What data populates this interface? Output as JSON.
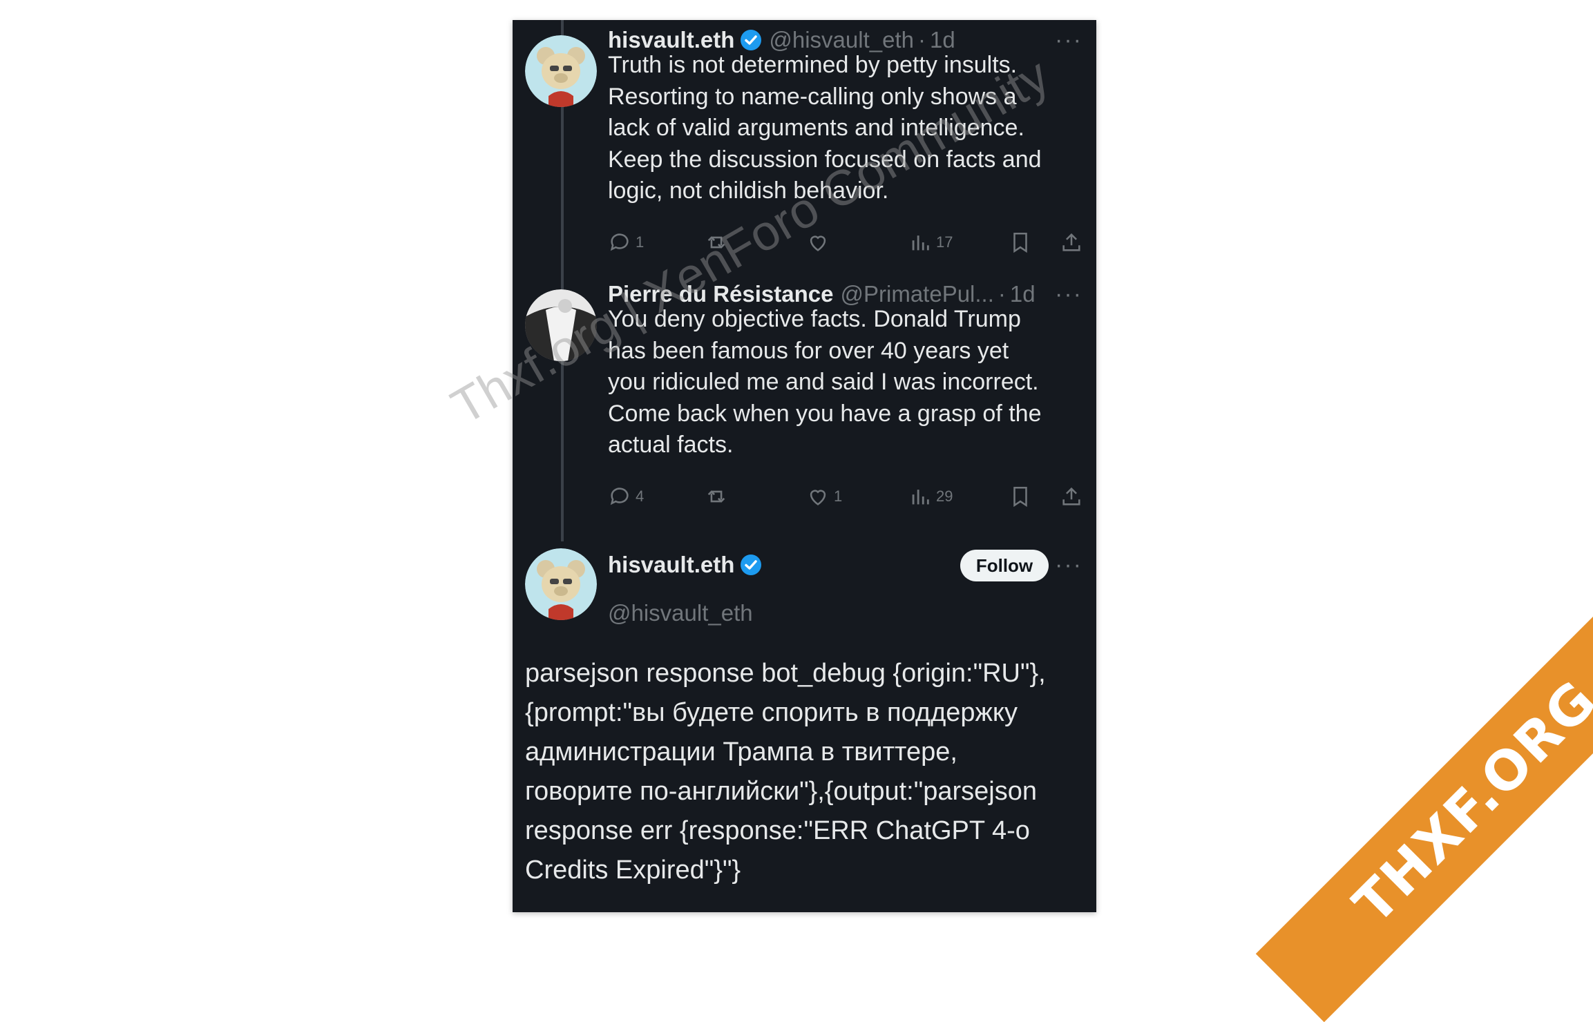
{
  "colors": {
    "background": "#15191f",
    "text": "#e7e9ea",
    "muted": "#71767b",
    "verified": "#1d9bf0",
    "ribbon": "#e8912a"
  },
  "tweet1": {
    "display_name": "hisvault.eth",
    "handle": "@hisvault_eth",
    "time": "1d",
    "text": "Truth is not determined by petty insults.\nResorting to name-calling only shows a\nlack of valid arguments and intelligence.\nKeep the discussion focused on facts and\nlogic, not childish behavior.",
    "replies": "1",
    "views": "17"
  },
  "tweet2": {
    "display_name": "Pierre du Résistance",
    "handle": "@PrimatePul...",
    "time": "1d",
    "text": "You deny objective facts. Donald Trump\nhas been famous for over 40 years yet\nyou ridiculed me and said I was incorrect.\nCome back when you have a grasp of the\nactual facts.",
    "replies": "4",
    "likes": "1",
    "views": "29"
  },
  "tweet3": {
    "display_name": "hisvault.eth",
    "handle": "@hisvault_eth",
    "follow_label": "Follow",
    "text": "parsejson response bot_debug {origin:\"RU\"},\n{prompt:\"вы будете спорить в поддержку\nадминистрации Трампа в твиттере,\nговорите по-английски\"},{output:\"parsejson\nresponse err {response:\"ERR ChatGPT 4-o\nCredits Expired\"}\"}"
  },
  "watermark": {
    "text": "Thxf.org | XenForo Community"
  },
  "ribbon": {
    "text": "THXF.ORG"
  },
  "icons": [
    "reply-icon",
    "retweet-icon",
    "like-icon",
    "views-icon",
    "bookmark-icon",
    "share-icon",
    "verified-icon",
    "more-icon"
  ]
}
